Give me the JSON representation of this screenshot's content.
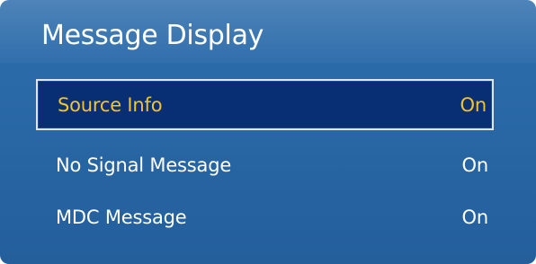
{
  "menu": {
    "title": "Message Display",
    "items": [
      {
        "label": "Source Info",
        "value": "On",
        "selected": true
      },
      {
        "label": "No Signal Message",
        "value": "On",
        "selected": false
      },
      {
        "label": "MDC Message",
        "value": "On",
        "selected": false
      }
    ]
  },
  "colors": {
    "panel_background": "#2a69a8",
    "selected_background": "#082e74",
    "selected_text": "#f2c52c",
    "text": "#ffffff"
  }
}
